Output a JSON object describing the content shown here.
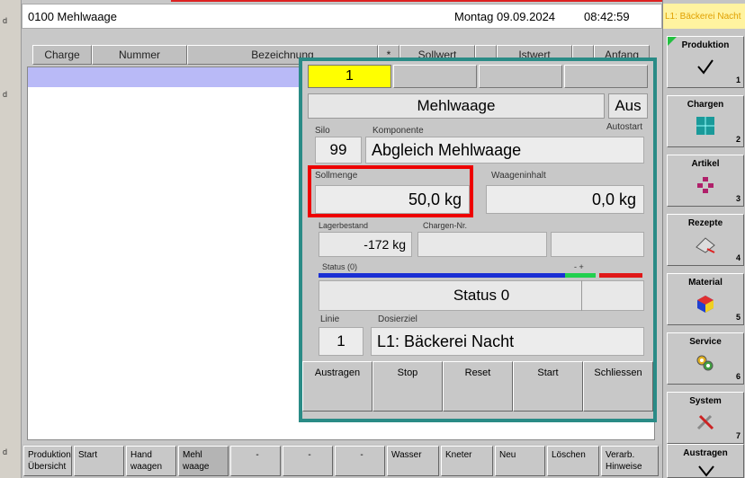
{
  "header": {
    "title": "0100  Mehlwaage",
    "date": "Montag 09.09.2024",
    "time": "08:42:59"
  },
  "columns": [
    "Charge",
    "Nummer",
    "Bezeichnung",
    "*",
    "Sollwert",
    "",
    "Istwert",
    "",
    "Anfang"
  ],
  "dialog": {
    "tabs": [
      "1",
      "",
      "",
      ""
    ],
    "title": "Mehlwaage",
    "mode": "Aus",
    "autostart_label": "Autostart",
    "silo_label": "Silo",
    "silo_value": "99",
    "component_label": "Komponente",
    "component_value": "Abgleich Mehlwaage",
    "sollmenge_label": "Sollmenge",
    "sollmenge_value": "50,0 kg",
    "waageninhalt_label": "Waageninhalt",
    "waageninhalt_value": "0,0 kg",
    "lagerbestand_label": "Lagerbestand",
    "lagerbestand_value": "-172 kg",
    "chargen_label": "Chargen-Nr.",
    "chargen_value": "",
    "status_label": "Status (0)",
    "status_marks": "- +",
    "status_value": "Status 0",
    "linie_label": "Linie",
    "linie_value": "1",
    "dosierziel_label": "Dosierziel",
    "dosierziel_value": "L1: Bäckerei Nacht",
    "buttons": [
      "Austragen",
      "Stop",
      "Reset",
      "Start",
      "Schliessen"
    ]
  },
  "sidebar": {
    "top_text": "L1: Bäckerei Nacht",
    "items": [
      {
        "label": "Produktion",
        "num": "1",
        "icon": "check-icon"
      },
      {
        "label": "Chargen",
        "num": "2",
        "icon": "chargen-grid-icon"
      },
      {
        "label": "Artikel",
        "num": "3",
        "icon": "artikel-dots-icon"
      },
      {
        "label": "Rezepte",
        "num": "4",
        "icon": "rezepte-book-icon"
      },
      {
        "label": "Material",
        "num": "5",
        "icon": "material-cube-icon"
      },
      {
        "label": "Service",
        "num": "6",
        "icon": "service-gears-icon"
      },
      {
        "label": "System",
        "num": "7",
        "icon": "system-tools-icon"
      },
      {
        "label": "Austragen",
        "num": "",
        "icon": "austragen-arrow-icon"
      }
    ]
  },
  "bottom": [
    {
      "l1": "Produktion",
      "l2": "Übersicht"
    },
    {
      "l1": "Start",
      "l2": ""
    },
    {
      "l1": "Hand",
      "l2": "waagen"
    },
    {
      "l1": "Mehl",
      "l2": "waage"
    },
    {
      "l1": "-",
      "l2": ""
    },
    {
      "l1": "-",
      "l2": ""
    },
    {
      "l1": "-",
      "l2": ""
    },
    {
      "l1": "Wasser",
      "l2": ""
    },
    {
      "l1": "Kneter",
      "l2": ""
    },
    {
      "l1": "Neu",
      "l2": ""
    },
    {
      "l1": "Löschen",
      "l2": ""
    },
    {
      "l1": "Verarb.",
      "l2": "Hinweise"
    }
  ]
}
